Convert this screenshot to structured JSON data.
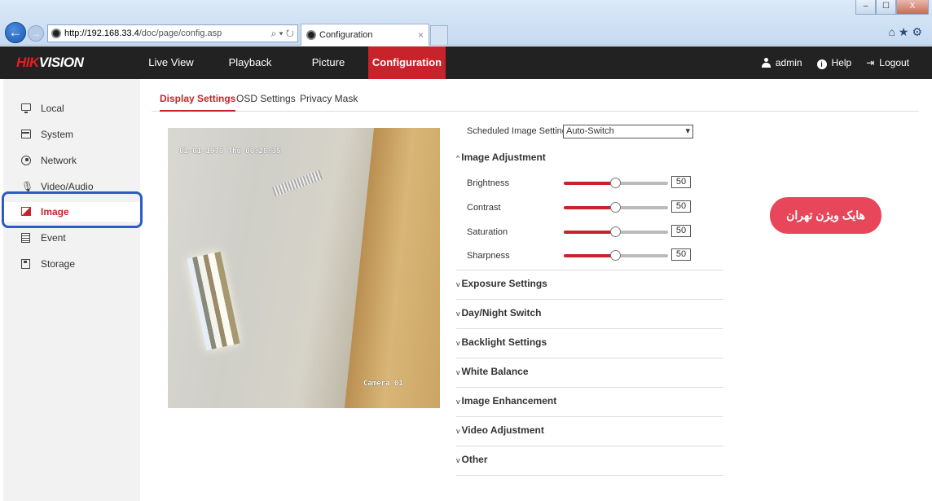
{
  "browser": {
    "url_host": "http://192.168.33.4",
    "url_path": "/doc/page/config.asp",
    "address_tools": "⌕ ▾ ↻",
    "tab_label": "Configuration",
    "tab_close": "×",
    "min": "–",
    "max": "☐",
    "close": "X",
    "toolbar_icons": "⌂★⚙"
  },
  "header": {
    "logo_red": "HIK",
    "logo_white": "VISION",
    "nav": [
      {
        "label": "Live View"
      },
      {
        "label": "Playback"
      },
      {
        "label": "Picture"
      },
      {
        "label": "Configuration"
      }
    ],
    "user": "admin",
    "help": "Help",
    "logout": "Logout",
    "help_glyph": "i",
    "logout_glyph": "⇥"
  },
  "sidebar": {
    "items": [
      {
        "label": "Local"
      },
      {
        "label": "System"
      },
      {
        "label": "Network"
      },
      {
        "label": "Video/Audio"
      },
      {
        "label": "Image"
      },
      {
        "label": "Event"
      },
      {
        "label": "Storage"
      }
    ]
  },
  "tabs": [
    {
      "label": "Display Settings"
    },
    {
      "label": "OSD Settings"
    },
    {
      "label": "Privacy Mask"
    }
  ],
  "preview": {
    "timestamp": "01-01-1970 Thu 00:28:35",
    "camera_name": "Camera 01"
  },
  "settings": {
    "scheduled_label": "Scheduled Image Settings",
    "scheduled_value": "Auto-Switch",
    "arrow": "▾",
    "image_adjustment": {
      "title": "Image Adjustment",
      "chevron": "^",
      "sliders": [
        {
          "label": "Brightness",
          "value": "50"
        },
        {
          "label": "Contrast",
          "value": "50"
        },
        {
          "label": "Saturation",
          "value": "50"
        },
        {
          "label": "Sharpness",
          "value": "50"
        }
      ]
    },
    "sections": [
      {
        "title": "Exposure Settings"
      },
      {
        "title": "Day/Night Switch"
      },
      {
        "title": "Backlight Settings"
      },
      {
        "title": "White Balance"
      },
      {
        "title": "Image Enhancement"
      },
      {
        "title": "Video Adjustment"
      },
      {
        "title": "Other"
      }
    ],
    "collapsed_chevron": "v"
  },
  "watermark": "هایک ویژن تهران",
  "colors": {
    "accent": "#c8232b",
    "header_bg": "#222222",
    "highlight_box": "#2f5bc6",
    "watermark_bg": "#e8465a"
  },
  "icons": {
    "back": "arrow-left-icon",
    "forward": "arrow-right-icon",
    "local": "monitor-icon",
    "system": "window-icon",
    "network": "globe-icon",
    "video_audio": "microphone-icon",
    "image": "image-icon",
    "event": "document-list-icon",
    "storage": "floppy-icon"
  }
}
